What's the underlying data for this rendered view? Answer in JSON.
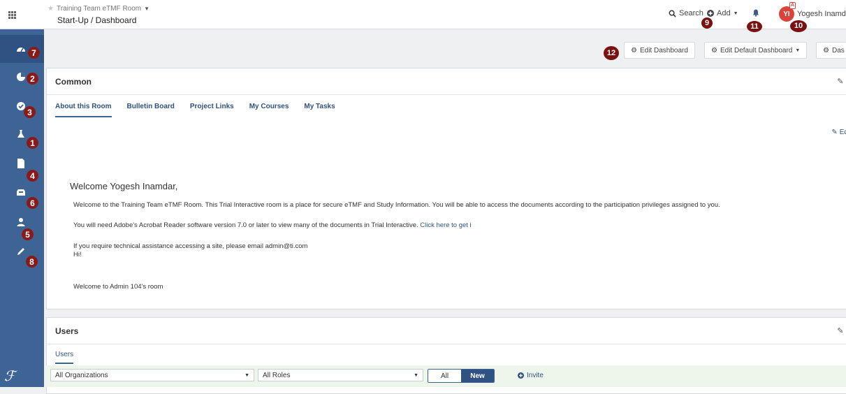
{
  "topbar": {
    "room_name": "Training Team eTMF Room",
    "page_title": "Start-Up / Dashboard",
    "search_label": "Search",
    "add_label": "Add",
    "user_initials": "YI",
    "user_badge": "A",
    "user_name": "Yogesh Inamda"
  },
  "sidebar": {
    "items": [
      {
        "name": "dashboard",
        "icon": "dashboard-icon"
      },
      {
        "name": "tasks",
        "icon": "pie-chart-icon"
      },
      {
        "name": "approvals",
        "icon": "check-circle-icon"
      },
      {
        "name": "studies",
        "icon": "flask-icon"
      },
      {
        "name": "documents",
        "icon": "file-icon"
      },
      {
        "name": "inbox",
        "icon": "inbox-icon"
      },
      {
        "name": "users",
        "icon": "users-icon"
      },
      {
        "name": "edit",
        "icon": "pencil-icon"
      }
    ]
  },
  "callouts": {
    "c1": "1",
    "c2": "2",
    "c3": "3",
    "c4": "4",
    "c5": "5",
    "c6": "6",
    "c7": "7",
    "c8": "8",
    "c9": "9",
    "c10": "10",
    "c11": "11",
    "c12": "12"
  },
  "dashboard_buttons": {
    "edit_dashboard": "Edit Dashboard",
    "edit_default_dashboard": "Edit Default Dashboard",
    "dash_truncated": "Das"
  },
  "common_panel": {
    "title": "Common",
    "tabs": [
      "About this Room",
      "Bulletin Board",
      "Project Links",
      "My Courses",
      "My Tasks"
    ],
    "edit_label": "Edit",
    "welcome_heading": "Welcome Yogesh Inamdar,",
    "para1": "Welcome to the Training Team eTMF Room.  This Trial Interactive room is a place for secure eTMF and Study Information. You will be able to access the documents according to the participation privileges assigned to you.",
    "para2_text": "You will need Adobe's Acrobat Reader software version 7.0 or later to view many of the documents in Trial Interactive. ",
    "para2_link": "Click here to get i",
    "para3": "If you require technical assistance accessing a site, please email admin@ti.com",
    "para4": "Hi!",
    "para5": "Welcome to Admin 104's room"
  },
  "users_panel": {
    "title": "Users",
    "tab": "Users",
    "org_select": "All Organizations",
    "role_select": "All Roles",
    "toggle_all": "All",
    "toggle_new": "New",
    "invite": "Invite"
  },
  "colors": {
    "sidebar": "#3e6496",
    "accent": "#2f5283",
    "callout": "#8a1a1a",
    "avatar": "#d9443a"
  }
}
